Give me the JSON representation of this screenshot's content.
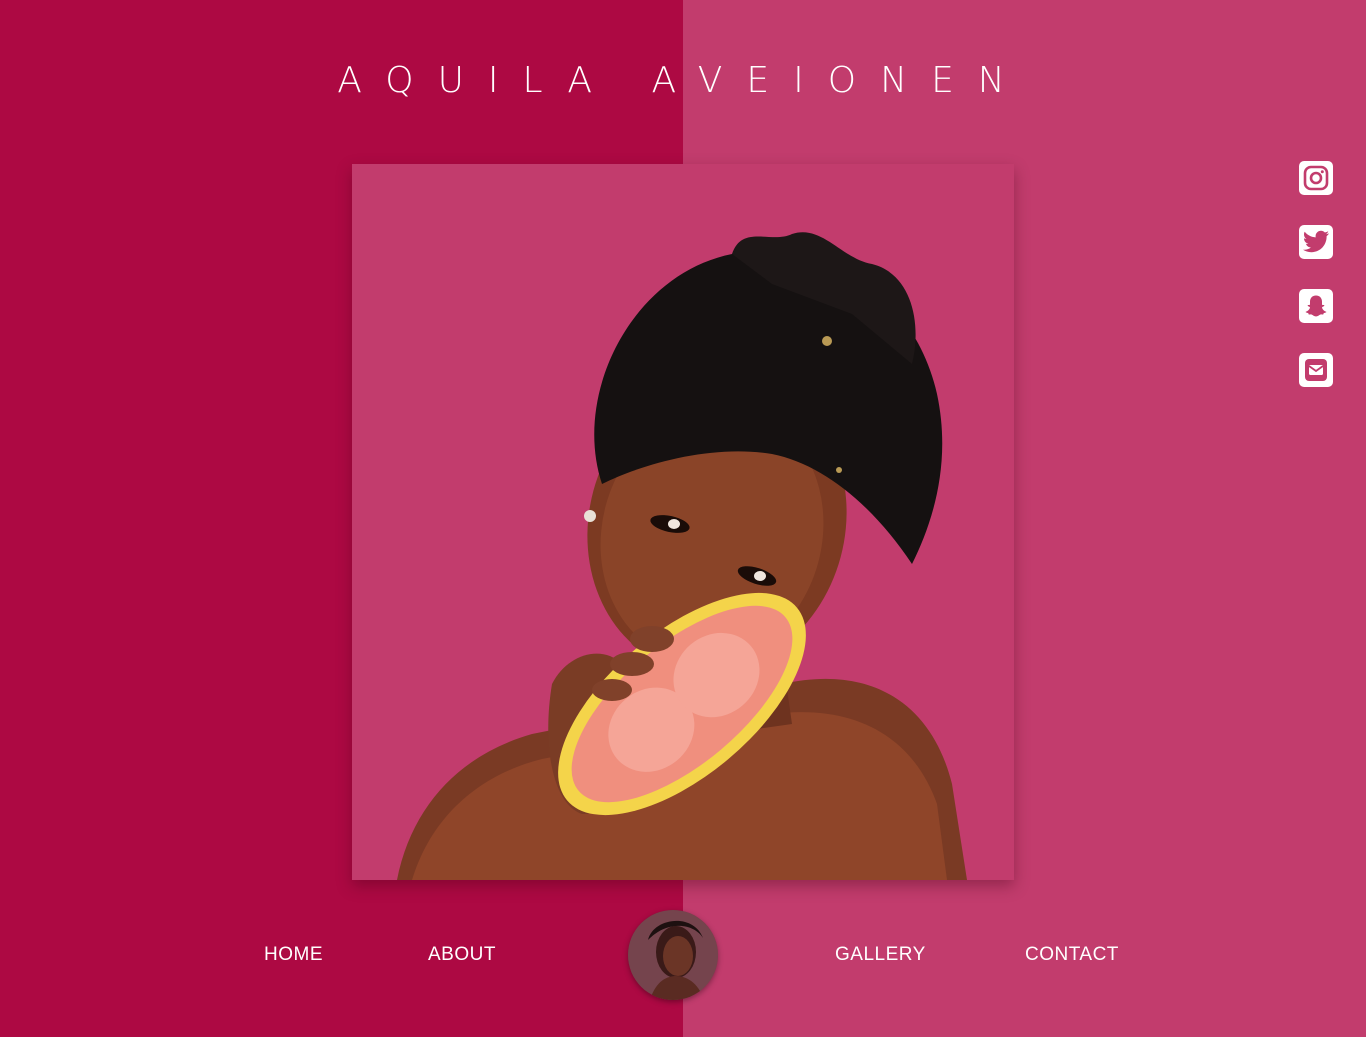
{
  "site": {
    "title": "AQUILA AVEIONEN"
  },
  "colors": {
    "left_panel": "#ad0943",
    "right_panel": "#c23c6d",
    "icon_fg": "#c23c6d"
  },
  "hero": {
    "image": "portrait-photo-woman-with-grapefruit"
  },
  "social": [
    {
      "icon": "instagram-icon"
    },
    {
      "icon": "twitter-icon"
    },
    {
      "icon": "snapchat-icon"
    },
    {
      "icon": "email-icon"
    }
  ],
  "nav": {
    "home": "HOME",
    "about": "ABOUT",
    "gallery": "GALLERY",
    "contact": "CONTACT",
    "avatar": "profile-avatar"
  }
}
